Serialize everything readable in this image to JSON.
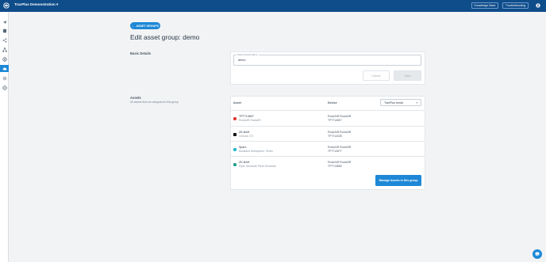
{
  "header": {
    "app_title": "TracPlus Demonstration",
    "knowledge_base": "Knowledge Base",
    "troubleshooting": "Troubleshooting"
  },
  "sidebar": {
    "items": [
      {
        "icon": "flight-icon"
      },
      {
        "icon": "database-icon"
      },
      {
        "icon": "share-icon"
      },
      {
        "icon": "org-chart-icon"
      },
      {
        "icon": "globe-icon"
      },
      {
        "icon": "cloud-icon",
        "active": true
      },
      {
        "icon": "gear-icon"
      },
      {
        "icon": "grid-icon"
      }
    ]
  },
  "breadcrumb": {
    "back_label": "ASSET GROUPS"
  },
  "page": {
    "title": "Edit asset group: demo"
  },
  "basic_details": {
    "title": "Basic Details",
    "field_label": "Asset Group Name",
    "field_value": "demo",
    "cancel_label": "Cancel",
    "save_label": "Save"
  },
  "assets": {
    "title": "Assets",
    "description": "All assets that are assigned to this group",
    "col_asset": "Asset",
    "col_device": "Device",
    "device_filter": "TracPlus serial",
    "rows": [
      {
        "name": "TPT714807",
        "sub": "RockAIR RockAIR",
        "device_type": "RockAIR RockAIR",
        "device_id": "TPT714807",
        "color": "#e0342f"
      },
      {
        "name": "ZK-NAH",
        "sub": "Cessna 172",
        "device_type": "RockAIR RockAIR",
        "device_id": "TPT714328",
        "color": "#1a1a1a"
      },
      {
        "name": "Sparx",
        "sub": "Auckland Helicopters, Tester",
        "device_type": "RockAIR RockAIR",
        "device_id": "TPT713577",
        "color": "#1fb6c8"
      },
      {
        "name": "ZK-NAH",
        "sub": "Piper Seminole PA44 Seminole",
        "device_type": "RockAIR RockAIR",
        "device_id": "TPT713880",
        "color": "#1f9a8a"
      }
    ],
    "manage_label": "Manage Assets in this group"
  },
  "colors": {
    "topbar": "#0f4c8a",
    "accent": "#1e88d6"
  }
}
